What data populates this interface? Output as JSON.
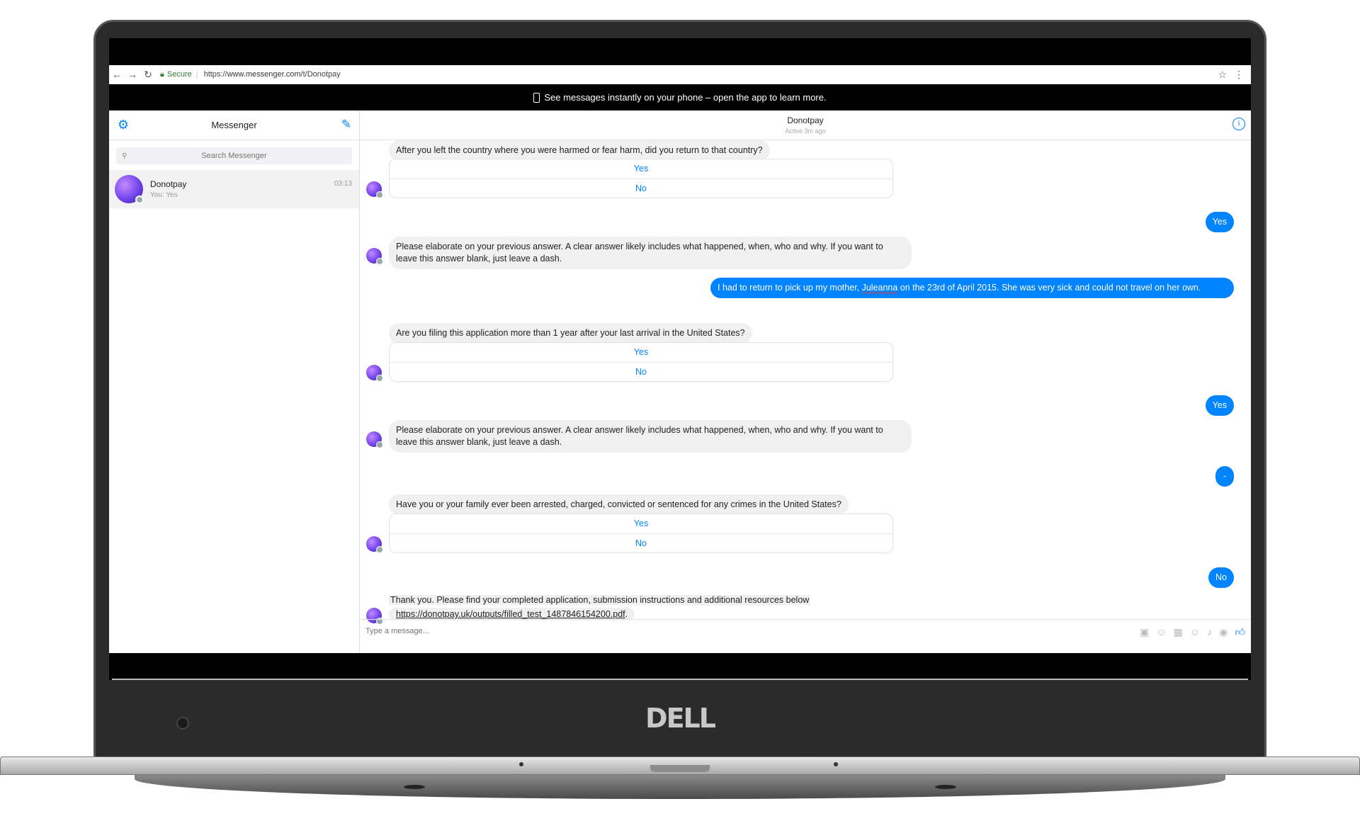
{
  "browser": {
    "back": "←",
    "forward": "→",
    "reload": "↻",
    "secure_label": "Secure",
    "url_scheme": "https://",
    "url_host": "www.messenger.com",
    "url_path": "/t/Donotpay",
    "star": "☆",
    "menu": "⋮"
  },
  "banner": {
    "text": "See messages instantly on your phone – open the app to learn more."
  },
  "sidebar": {
    "title": "Messenger",
    "search_placeholder": "Search Messenger",
    "conversations": [
      {
        "name": "Donotpay",
        "snippet": "You: Yes",
        "time": "03:13"
      }
    ]
  },
  "chat": {
    "title": "Donotpay",
    "status": "Active 3m ago",
    "composer_placeholder": "Type a message...",
    "messages": {
      "q1": "After you left the country where you were harmed or fear harm, did you return to that country?",
      "q1_yes": "Yes",
      "q1_no": "No",
      "a1": "Yes",
      "q2": "Please elaborate on your previous answer. A clear answer likely includes what happened, when, who and why. If you want to leave this answer blank, just leave a dash.",
      "a2_pre": "I had to return to pick up my mother, ",
      "a2_name": "Juleanna",
      "a2_post": " on the 23rd of April 2015. She was very sick and could not travel on her own.",
      "q3": "Are you filing this application more than 1 year after your last arrival in the United States?",
      "q3_yes": "Yes",
      "q3_no": "No",
      "a3": "Yes",
      "q4": "Please elaborate on your previous answer. A clear answer likely includes what happened, when, who and why. If you want to leave this answer blank, just leave a dash.",
      "a4": "-",
      "q5": "Have you or your family ever been arrested, charged, convicted or sentenced for any crimes in the United States?",
      "q5_yes": "Yes",
      "q5_no": "No",
      "a5": "No",
      "final_text": "Thank you. Please find your completed application, submission instructions and additional resources below",
      "final_link": "https://donotpay.uk/outputs/filled_test_1487846154200.pdf",
      "final_period": "."
    }
  },
  "laptop": {
    "brand": "DELL"
  },
  "colors": {
    "accent": "#0084ff",
    "incoming_bubble": "#f1f0f0",
    "banner": "#000000"
  },
  "icons": {
    "settings": "gear-icon",
    "compose": "compose-icon",
    "info": "info-icon",
    "search": "search-icon",
    "like": "thumbs-up-icon"
  }
}
